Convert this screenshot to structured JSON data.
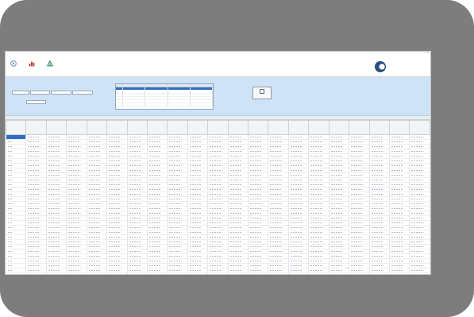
{
  "window": {
    "title": "",
    "controls": [
      "–",
      "□",
      "✕"
    ]
  },
  "menu": {
    "items": [
      "",
      "",
      ""
    ]
  },
  "toolbar": {
    "buttons": [
      {
        "icon": "run-icon",
        "label": "",
        "color": "#5a7fa8"
      },
      {
        "icon": "chart-icon",
        "label": "",
        "color": "#c0392b"
      },
      {
        "icon": "recycle-icon",
        "label": "",
        "color": "#2e8b57"
      }
    ],
    "logo_text": ""
  },
  "inputs": {
    "group_title": "",
    "fields": [
      {
        "label": "",
        "value": ""
      },
      {
        "label": "",
        "value": ""
      },
      {
        "label": "",
        "value": ""
      },
      {
        "label": "",
        "value": ""
      }
    ],
    "extra_field": {
      "value": "",
      "label": ""
    }
  },
  "selection": {
    "group_title": "",
    "columns": [
      "",
      "",
      "",
      ""
    ],
    "rows": [
      [
        "",
        "",
        "",
        ""
      ],
      [
        "",
        "",
        "",
        ""
      ],
      [
        "",
        "",
        "",
        ""
      ],
      [
        "",
        "",
        "",
        ""
      ],
      [
        "",
        "",
        "",
        ""
      ],
      [
        "",
        "",
        "",
        ""
      ]
    ],
    "selected_row": 0
  },
  "compute": {
    "field_label": "",
    "button_label": ""
  },
  "results": {
    "title": "",
    "columns": [
      "",
      "",
      "",
      "",
      "",
      "",
      "",
      "",
      "",
      "",
      "",
      "",
      "",
      "",
      "",
      "",
      "",
      "",
      "",
      "",
      ""
    ],
    "row_count": 30,
    "selected_row": 0
  },
  "colors": {
    "frame": "#7d7d7d",
    "input_band": "#cfe3f6",
    "selection": "#2f6fc1",
    "brand": "#27507f"
  }
}
